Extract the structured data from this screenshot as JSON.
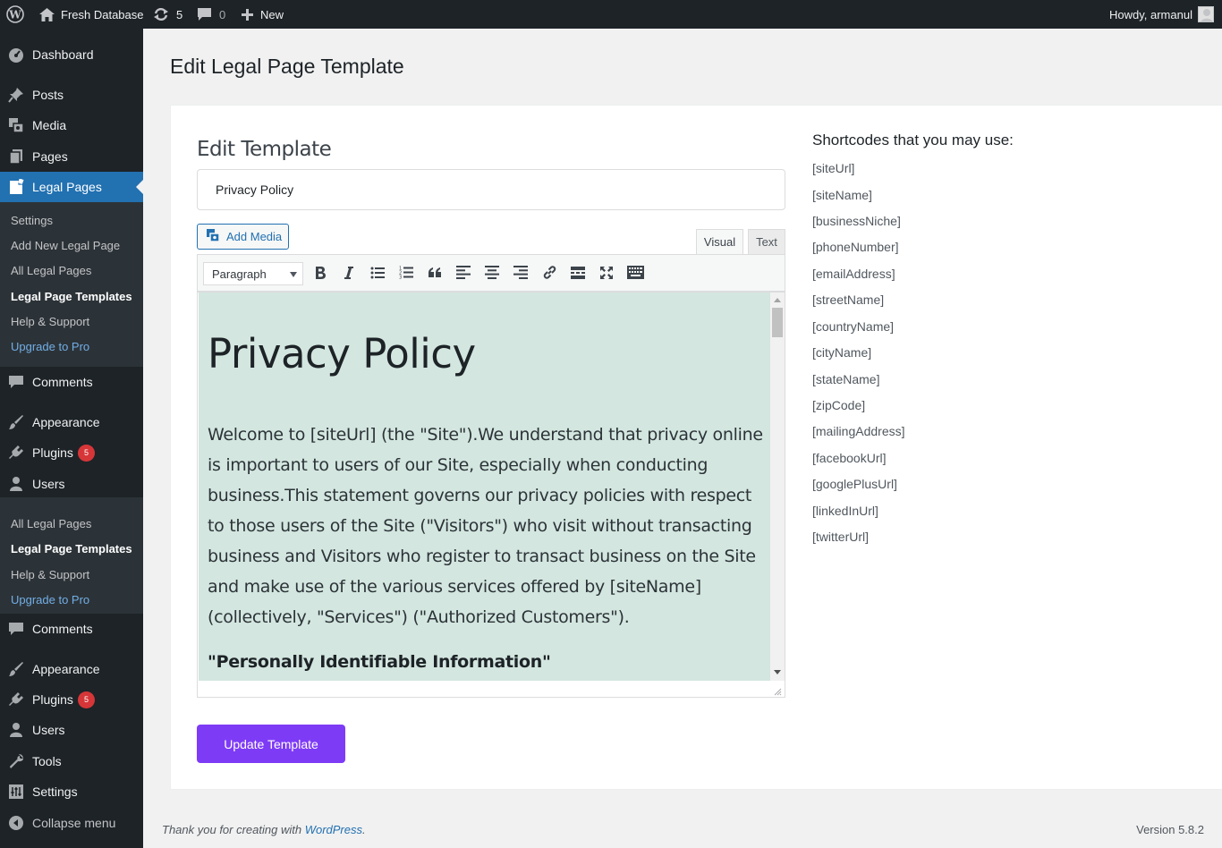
{
  "admin_bar": {
    "site_name": "Fresh Database",
    "updates_count": "5",
    "comments_count": "0",
    "new_label": "New",
    "greeting": "Howdy, armanul"
  },
  "sidebar": {
    "dashboard": "Dashboard",
    "posts": "Posts",
    "media": "Media",
    "pages": "Pages",
    "legal_pages": "Legal Pages",
    "submenu": [
      "Settings",
      "Add New Legal Page",
      "All Legal Pages",
      "Legal Page Templates",
      "Help & Support",
      "Upgrade to Pro"
    ],
    "comments": "Comments",
    "appearance": "Appearance",
    "plugins": "Plugins",
    "plugins_badge": "5",
    "users": "Users",
    "submenu_repeat": [
      "All Legal Pages",
      "Legal Page Templates",
      "Help & Support",
      "Upgrade to Pro"
    ],
    "tools": "Tools",
    "settings": "Settings",
    "collapse": "Collapse menu"
  },
  "main": {
    "page_title": "Edit Legal Page Template",
    "section_title": "Edit Template",
    "template_title_value": "Privacy Policy",
    "add_media_label": "Add Media",
    "tab_visual": "Visual",
    "tab_text": "Text",
    "format_select_value": "Paragraph",
    "editor": {
      "heading": "Privacy Policy",
      "paragraph": "Welcome to [siteUrl] (the \"Site\").We understand that privacy online is important to users of our Site, especially when conducting business.This statement governs our privacy policies with respect to those users of the Site (\"Visitors\") who visit without transacting business and Visitors who register to transact business on the Site and make use of the various services offered by [siteName] (collectively, \"Services\") (\"Authorized Customers\").",
      "subheading": "\"Personally Identifiable Information\""
    },
    "update_button": "Update Template"
  },
  "shortcodes": {
    "title": "Shortcodes that you may use:",
    "items": [
      "[siteUrl]",
      "[siteName]",
      "[businessNiche]",
      "[phoneNumber]",
      "[emailAddress]",
      "[streetName]",
      "[countryName]",
      "[cityName]",
      "[stateName]",
      "[zipCode]",
      "[mailingAddress]",
      "[facebookUrl]",
      "[googlePlusUrl]",
      "[linkedInUrl]",
      "[twitterUrl]"
    ]
  },
  "footer": {
    "thanks_prefix": "Thank you for creating with ",
    "wordpress_link": "WordPress",
    "thanks_suffix": ".",
    "version": "Version 5.8.2"
  },
  "colors": {
    "admin_dark": "#1d2327",
    "current_menu": "#2271b1",
    "editor_background": "#d3e6df",
    "update_button": "#7e3bf6",
    "badge": "#d63638"
  }
}
